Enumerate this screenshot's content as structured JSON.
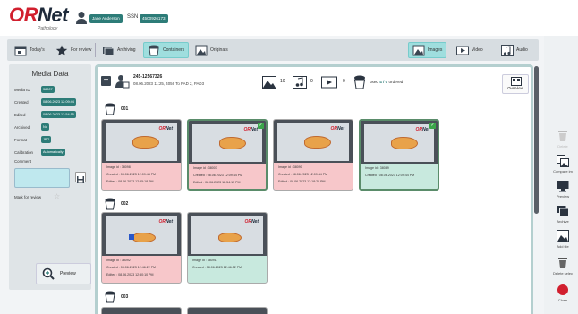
{
  "header": {
    "logo_or": "OR",
    "logo_net": "Net",
    "logo_sub": "Pathology",
    "user_name": "Jane Anderson",
    "ssn_label": "SSN",
    "ssn_value": "4500926173"
  },
  "toolbar": {
    "todays": "Today's",
    "for_review": "For review",
    "archiving": "Archiving",
    "containers": "Containers",
    "originals": "Originals",
    "images": "Images",
    "video": "Video",
    "audio": "Audio"
  },
  "media_data": {
    "title": "Media Data",
    "fields": [
      {
        "label": "Media ID",
        "value": "38007"
      },
      {
        "label": "Created",
        "value": "08.06.2023 12:09:44"
      },
      {
        "label": "Edited",
        "value": "08.06.2023 12:54:15"
      },
      {
        "label": "Archived",
        "value": "No"
      },
      {
        "label": "Format",
        "value": "JPG"
      },
      {
        "label": "Calibration",
        "value": "Automatically"
      },
      {
        "label": "Comment",
        "value": ""
      }
    ],
    "mark_for_review": "Mark for review",
    "preview": "Preview"
  },
  "container": {
    "patient_id": "245-12567326",
    "patient_info": "08.06.2023 11:25, 4056 To PAD 2, PAD3",
    "images_count": "10",
    "audio_count": "0",
    "video_count": "0",
    "used_prefix": "used",
    "used_value": "4 / 0",
    "used_suffix": "ordered",
    "overview": "Overview"
  },
  "groups": [
    {
      "label": "001",
      "cards": [
        {
          "image_id": "Image id : 38098",
          "created": "Created : 08.06.2023 12:09:44 PM",
          "edited": "Edited : 08.06.2023 12:55:18 PM",
          "status": "red",
          "checked": false,
          "selected": false
        },
        {
          "image_id": "Image id : 38007",
          "created": "Created : 08.06.2023 12:09:44 PM",
          "edited": "Edited : 08.06.2023 12:54:15 PM",
          "status": "red",
          "checked": true,
          "selected": true
        },
        {
          "image_id": "Image id : 38090",
          "created": "Created : 08.06.2023 12:09:44 PM",
          "edited": "Edited : 08.06.2023 12:18:20 PM",
          "status": "red",
          "checked": false,
          "selected": false
        },
        {
          "image_id": "Image id : 38089",
          "created": "Created : 08.06.2023 12:09:44 PM",
          "edited": "",
          "status": "green",
          "checked": true,
          "selected": true
        }
      ]
    },
    {
      "label": "002",
      "cards": [
        {
          "image_id": "Image id : 38092",
          "created": "Created : 08.06.2023 12:46:22 PM",
          "edited": "Edited : 08.06.2023 12:50:10 PM",
          "status": "red",
          "checked": false,
          "selected": false
        },
        {
          "image_id": "Image id : 38091",
          "created": "Created : 08.06.2023 12:46:52 PM",
          "edited": "",
          "status": "green",
          "checked": false,
          "selected": false
        }
      ]
    },
    {
      "label": "003",
      "cards": []
    }
  ],
  "right_bar": {
    "delete": "Delete",
    "compare": "Compare im",
    "preview": "Preview",
    "archive": "Archive",
    "add_file": "Add file",
    "delete_selected": "Delete selec",
    "close": "Close"
  }
}
